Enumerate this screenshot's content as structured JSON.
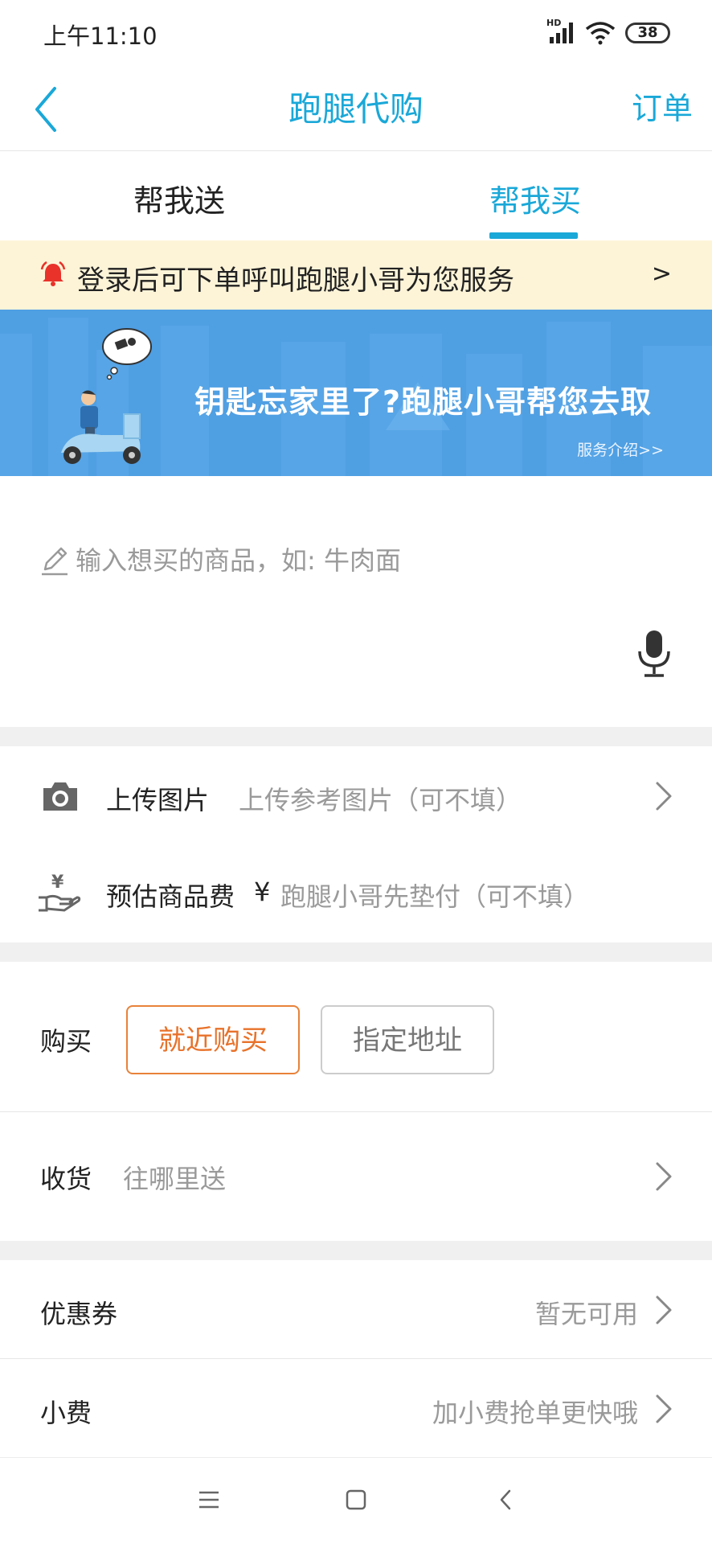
{
  "status_bar": {
    "time": "上午11:10",
    "network": "HD",
    "battery": "38"
  },
  "nav": {
    "title": "跑腿代购",
    "order_link": "订单"
  },
  "tabs": [
    {
      "label": "帮我送",
      "active": false
    },
    {
      "label": "帮我买",
      "active": true
    }
  ],
  "notice": {
    "text": "登录后可下单呼叫跑腿小哥为您服务",
    "arrow": ">"
  },
  "banner": {
    "headline": "钥匙忘家里了?跑腿小哥帮您去取",
    "link": "服务介绍>>"
  },
  "item_input": {
    "placeholder": "输入想买的商品，如: 牛肉面"
  },
  "upload": {
    "label": "上传图片",
    "hint": "上传参考图片（可不填）"
  },
  "estimate": {
    "label": "预估商品费",
    "currency": "¥",
    "hint": "跑腿小哥先垫付（可不填）"
  },
  "purchase": {
    "label": "购买",
    "options": [
      "就近购买",
      "指定地址"
    ],
    "selected": "就近购买"
  },
  "receive": {
    "label": "收货",
    "hint": "往哪里送"
  },
  "coupon": {
    "label": "优惠券",
    "value": "暂无可用"
  },
  "tip": {
    "label": "小费",
    "value": "加小费抢单更快哦"
  },
  "colors": {
    "accent": "#1aa8d8",
    "orange": "#e8722a",
    "notice_bg": "#fdf4d8",
    "banner_bg": "#4f9fe3"
  }
}
